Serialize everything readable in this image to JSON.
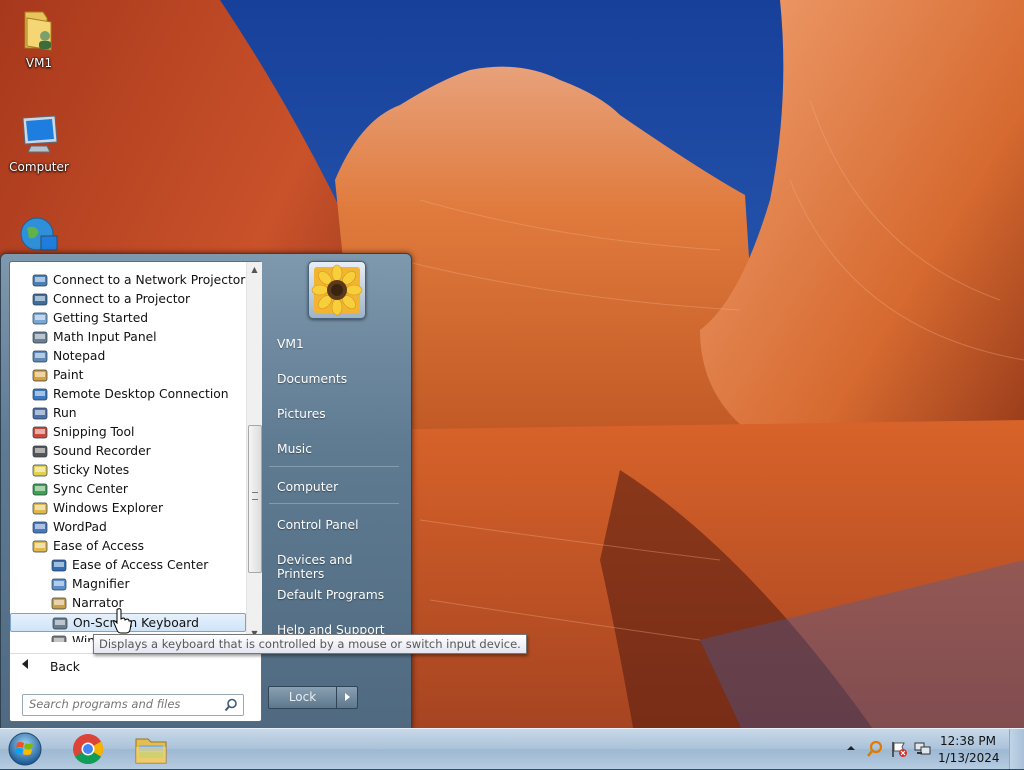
{
  "desktop": {
    "icons": [
      {
        "label": "VM1",
        "icon": "user-folder-icon"
      },
      {
        "label": "Computer",
        "icon": "computer-icon"
      },
      {
        "label": "",
        "icon": "network-icon"
      }
    ]
  },
  "start_menu": {
    "programs": [
      {
        "label": "Connect to a Network Projector",
        "icon": "network-projector-icon"
      },
      {
        "label": "Connect to a Projector",
        "icon": "projector-icon"
      },
      {
        "label": "Getting Started",
        "icon": "getting-started-icon"
      },
      {
        "label": "Math Input Panel",
        "icon": "math-input-icon"
      },
      {
        "label": "Notepad",
        "icon": "notepad-icon"
      },
      {
        "label": "Paint",
        "icon": "paint-icon"
      },
      {
        "label": "Remote Desktop Connection",
        "icon": "remote-desktop-icon"
      },
      {
        "label": "Run",
        "icon": "run-icon"
      },
      {
        "label": "Snipping Tool",
        "icon": "snipping-tool-icon"
      },
      {
        "label": "Sound Recorder",
        "icon": "microphone-icon"
      },
      {
        "label": "Sticky Notes",
        "icon": "sticky-notes-icon"
      },
      {
        "label": "Sync Center",
        "icon": "sync-center-icon"
      },
      {
        "label": "Windows Explorer",
        "icon": "folder-icon"
      },
      {
        "label": "WordPad",
        "icon": "wordpad-icon"
      },
      {
        "label": "Ease of Access",
        "icon": "folder-icon"
      },
      {
        "label": "Ease of Access Center",
        "icon": "ease-of-access-icon"
      },
      {
        "label": "Magnifier",
        "icon": "magnifier-icon"
      },
      {
        "label": "Narrator",
        "icon": "narrator-icon"
      },
      {
        "label": "On-Screen Keyboard",
        "icon": "keyboard-icon"
      },
      {
        "label": "Windows Speech Recognition",
        "icon": "microphone-icon"
      }
    ],
    "selected_program": "On-Screen Keyboard",
    "back_label": "Back",
    "search_placeholder": "Search programs and files",
    "right_items": [
      {
        "label": "VM1"
      },
      {
        "label": "Documents"
      },
      {
        "label": "Pictures"
      },
      {
        "label": "Music"
      },
      {
        "label": "Computer"
      },
      {
        "label": "Control Panel"
      },
      {
        "label": "Devices and Printers"
      },
      {
        "label": "Default Programs"
      },
      {
        "label": "Help and Support"
      }
    ],
    "lock_label": "Lock"
  },
  "tooltip": "Displays a keyboard that is controlled by a mouse or switch input device.",
  "taskbar": {
    "apps": [
      {
        "icon": "chrome-icon"
      },
      {
        "icon": "file-explorer-icon"
      }
    ],
    "clock_time": "12:38 PM",
    "clock_date": "1/13/2024"
  },
  "colors": {
    "sky": "#1f4fa5",
    "rock": "#e06a2c",
    "taskbar": "#aac2d9",
    "start_menu": "#5f7b92",
    "selection": "#cfe4f8"
  }
}
